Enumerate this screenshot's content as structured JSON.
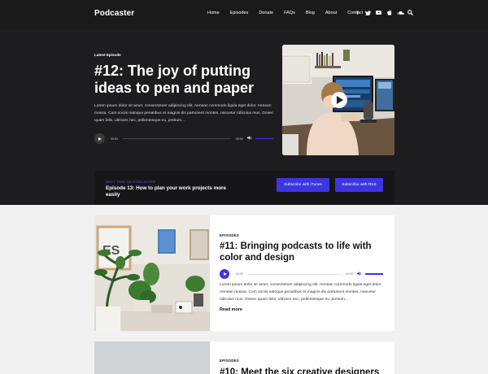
{
  "nav": {
    "brand": "Podcaster",
    "items": [
      "Home",
      "Episodes",
      "Donate",
      "FAQs",
      "Blog",
      "About",
      "Contact"
    ]
  },
  "hero": {
    "label": "Latest Episode",
    "title": "#12: The joy of putting ideas to pen and paper",
    "text": "Lorem ipsum dolor sit amet, consectetuer adipiscing elit. Aenean commodo ligula eget dolor. Aenean massa. Cum sociis natoque penatibus et magnis dis parturient montes, nascetur ridiculus mus. Donec quam felis, ultricies nec, pellentesque eu, pretium...",
    "player": {
      "current": "00:00",
      "duration": "00:00",
      "volume": 1.0
    }
  },
  "next": {
    "label": "NEXT TIME ON PODCASTER",
    "title": "Episode 13: How to plan your work projects more easily",
    "itunes_button": "Subscribe with iTunes",
    "rss_button": "Subscribe with RSS"
  },
  "cards": [
    {
      "category": "EPISODES",
      "title": "#11: Bringing podcasts to life with color and design",
      "player": {
        "current": "00:00",
        "duration": "00:00",
        "volume": 1.0
      },
      "text": "Lorem ipsum dolor sit amet, consectetuer adipiscing elit. Aenean commodo ligula eget dolor. Aenean massa. Cum sociis natoque penatibus et magnis dis parturient montes, nascetur ridiculus mus. Donec quam felis, ultricies nec, pellentesque eu, pretium...",
      "read_more": "Read more"
    },
    {
      "category": "EPISODES",
      "title": "#10: Meet the six creative designers"
    }
  ],
  "icons": {
    "social": [
      "facebook-icon",
      "twitter-icon",
      "youtube-icon",
      "apple-podcasts-icon",
      "soundcloud-icon"
    ],
    "search": "search-icon"
  },
  "colors": {
    "accent": "#3c36e0",
    "dark": "#1d1d1f",
    "background": "#f1f1f1"
  }
}
